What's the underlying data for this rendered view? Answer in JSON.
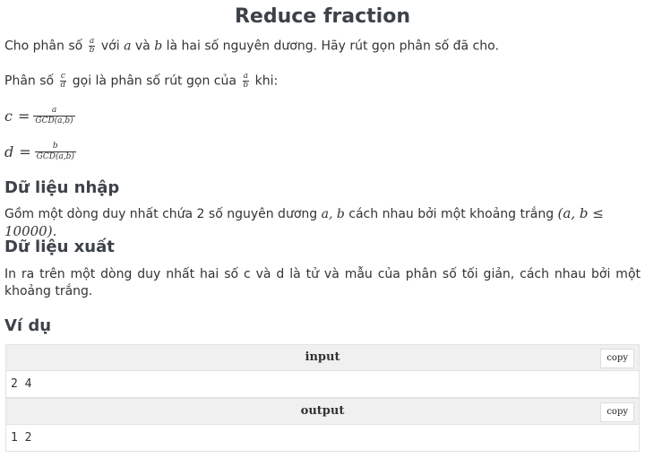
{
  "title": "Reduce fraction",
  "intro": {
    "prefix": "Cho phân số",
    "frac": {
      "num": "a",
      "den": "b"
    },
    "middle1": "với",
    "var_a": "a",
    "middle2": "và",
    "var_b": "b",
    "suffix": "là hai số nguyên dương. Hãy rút gọn phân số đã cho."
  },
  "def": {
    "prefix": "Phân số",
    "frac1": {
      "num": "c",
      "den": "d"
    },
    "middle": "gọi là phân số rút gọn của",
    "frac2": {
      "num": "a",
      "den": "b"
    },
    "suffix": "khi:"
  },
  "formulas": [
    {
      "var": "c",
      "sym": "=",
      "num": "a",
      "den": "GCD(a,b)"
    },
    {
      "var": "d",
      "sym": "=",
      "num": "b",
      "den": "GCD(a,b)"
    }
  ],
  "input_section": {
    "heading": "Dữ liệu nhập",
    "text_prefix": "Gồm một dòng duy nhất chứa 2 số nguyên dương",
    "vars": "a, b",
    "text_middle": "cách nhau bởi một khoảng trắng",
    "constraint": "(a, b ≤ 10000)."
  },
  "output_section": {
    "heading": "Dữ liệu xuất",
    "text": "In ra trên một dòng duy nhất hai số c và d là tử và mẫu của phân số tối giản, cách nhau bởi một khoảng trắng."
  },
  "example": {
    "heading": "Ví dụ",
    "input_label": "input",
    "input_value": "2 4",
    "output_label": "output",
    "output_value": "1 2",
    "copy_label": "copy"
  }
}
